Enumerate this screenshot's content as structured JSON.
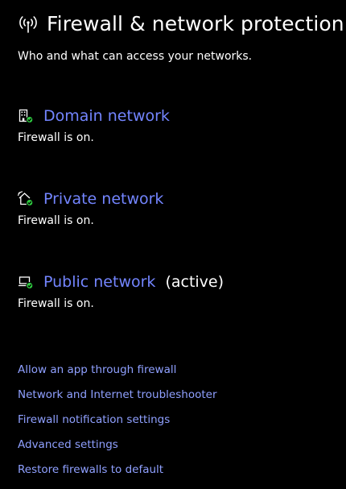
{
  "header": {
    "title": "Firewall & network protection",
    "icon": "firewall-signal-icon",
    "subtitle": "Who and what can access your networks."
  },
  "networks": [
    {
      "icon": "domain-network-icon",
      "label": "Domain network",
      "suffix": "",
      "status": "Firewall is on."
    },
    {
      "icon": "private-network-icon",
      "label": "Private network",
      "suffix": "",
      "status": "Firewall is on."
    },
    {
      "icon": "public-network-icon",
      "label": "Public network",
      "suffix": "(active)",
      "status": "Firewall is on."
    }
  ],
  "links": [
    "Allow an app through firewall",
    "Network and Internet troubleshooter",
    "Firewall notification settings",
    "Advanced settings",
    "Restore firewalls to default"
  ],
  "colors": {
    "background": "#000000",
    "text": "#ffffff",
    "link": "#7385ff",
    "status_ok": "#2ecc40"
  }
}
